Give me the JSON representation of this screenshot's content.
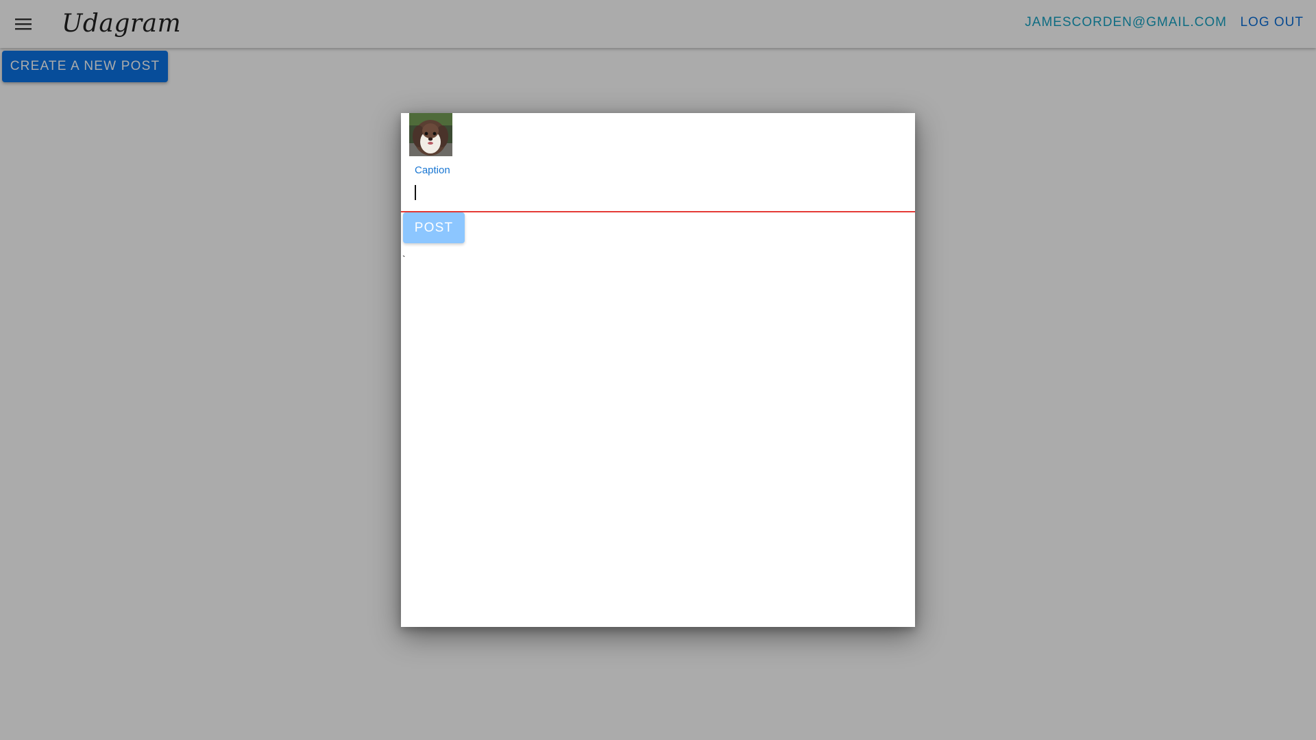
{
  "header": {
    "menu_icon": "hamburger-menu-icon",
    "brand": "Udagram",
    "user_email": "JAMESCORDEN@GMAIL.COM",
    "logout_label": "LOG OUT"
  },
  "main": {
    "create_post_label": "CREATE A NEW POST"
  },
  "modal": {
    "stray_mark": "`",
    "image_alt": "dog photo preview",
    "caption_label": "Caption",
    "caption_value": "",
    "post_label": "POST"
  },
  "colors": {
    "primary": "#0b74e6",
    "email": "#15a2c2",
    "error_underline": "#e53935",
    "disabled_button": "#8cc6ff"
  }
}
